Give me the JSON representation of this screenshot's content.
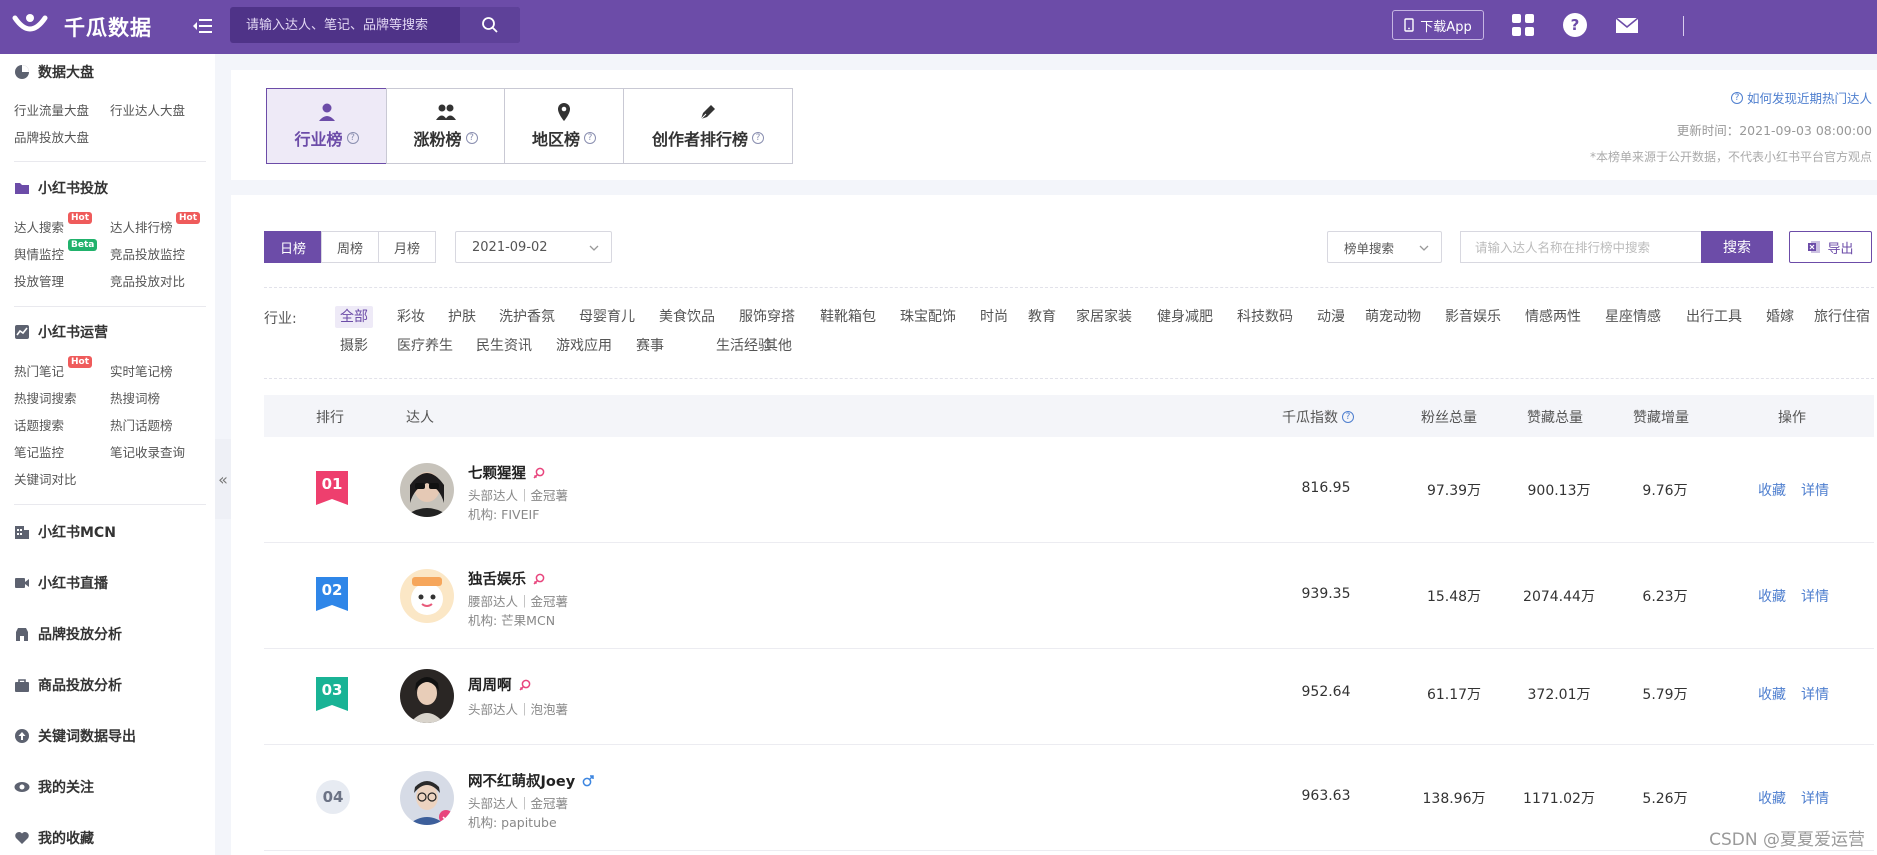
{
  "topbar": {
    "brand": "千瓜数据",
    "search_placeholder": "请输入达人、笔记、品牌等搜索",
    "download_app": "下载App"
  },
  "sidebar": {
    "sections": [
      {
        "title": "数据大盘",
        "icon": "pie-chart-icon",
        "items": [
          "行业流量大盘",
          "行业达人大盘",
          "品牌投放大盘"
        ]
      },
      {
        "title": "小红书投放",
        "icon": "folder-icon",
        "items": [
          "达人搜索",
          "达人排行榜",
          "舆情监控",
          "竞品投放监控",
          "投放管理",
          "竞品投放对比"
        ]
      },
      {
        "title": "小红书运营",
        "icon": "trend-chart-icon",
        "items": [
          "热门笔记",
          "实时笔记榜",
          "热搜词搜索",
          "热搜词榜",
          "话题搜索",
          "热门话题榜",
          "笔记监控",
          "笔记收录查询",
          "关键词对比"
        ]
      },
      {
        "title": "小红书MCN",
        "icon": "building-icon"
      },
      {
        "title": "小红书直播",
        "icon": "video-icon"
      },
      {
        "title": "品牌投放分析",
        "icon": "shop-icon"
      },
      {
        "title": "商品投放分析",
        "icon": "bag-icon"
      },
      {
        "title": "关键词数据导出",
        "icon": "upload-icon"
      },
      {
        "title": "我的关注",
        "icon": "eye-icon"
      },
      {
        "title": "我的收藏",
        "icon": "heart-icon"
      }
    ],
    "badges": {
      "hot": "Hot",
      "beta": "Beta"
    }
  },
  "boards": {
    "tabs": [
      "行业榜",
      "涨粉榜",
      "地区榜",
      "创作者排行榜"
    ],
    "help_link": "如何发现近期热门达人",
    "update_time": "更新时间：2021-09-03 08:00:00",
    "source_note": "*本榜单来源于公开数据，不代表小红书平台官方观点"
  },
  "filters": {
    "periods": [
      "日榜",
      "周榜",
      "月榜"
    ],
    "date": "2021-09-02",
    "list_search": "榜单搜索",
    "rank_search_placeholder": "请输入达人名称在排行榜中搜索",
    "search_btn": "搜索",
    "export_btn": "导出",
    "industry_label": "行业:",
    "industries": [
      "全部",
      "彩妆",
      "护肤",
      "洗护香氛",
      "母婴育儿",
      "美食饮品",
      "服饰穿搭",
      "鞋靴箱包",
      "珠宝配饰",
      "时尚",
      "教育",
      "家居家装",
      "健身减肥",
      "科技数码",
      "动漫",
      "萌宠动物",
      "影音娱乐",
      "情感两性",
      "星座情感",
      "出行工具",
      "婚嫁",
      "旅行住宿",
      "摄影",
      "医疗养生",
      "民生资讯",
      "游戏应用",
      "赛事",
      "生活经验",
      "其他"
    ]
  },
  "table": {
    "headers": [
      "排行",
      "达人",
      "千瓜指数",
      "粉丝总量",
      "赞藏总量",
      "赞藏增量",
      "操作"
    ],
    "actions": [
      "收藏",
      "详情"
    ],
    "rows": [
      {
        "rank": "01",
        "name": "七颗猩猩",
        "gender": "female",
        "sub": "头部达人｜金冠薯",
        "org": "机构:  FIVEIF",
        "index": "816.95",
        "fans": "97.39万",
        "likes": "900.13万",
        "likes_inc": "9.76万",
        "rank_color": "#ee3f6e"
      },
      {
        "rank": "02",
        "name": "独舌娱乐",
        "gender": "female",
        "sub": "腰部达人｜金冠薯",
        "org": "机构:  芒果MCN",
        "index": "939.35",
        "fans": "15.48万",
        "likes": "2074.44万",
        "likes_inc": "6.23万",
        "rank_color": "#2f86e8"
      },
      {
        "rank": "03",
        "name": "周周啊",
        "gender": "female",
        "sub": "头部达人｜泡泡薯",
        "org": "",
        "index": "952.64",
        "fans": "61.17万",
        "likes": "372.01万",
        "likes_inc": "5.79万",
        "rank_color": "#19b395"
      },
      {
        "rank": "04",
        "name": "网不红萌叔Joey",
        "gender": "male",
        "sub": "头部达人｜金冠薯",
        "org": "机构:  papitube",
        "index": "963.63",
        "fans": "138.96万",
        "likes": "1171.02万",
        "likes_inc": "5.26万",
        "rank_color": ""
      }
    ]
  },
  "watermark": "CSDN @夏夏爱运营",
  "colors": {
    "brand": "#6c4ca8",
    "link": "#4f7fcf",
    "hot": "#ef5b5b",
    "beta": "#21b26c"
  }
}
